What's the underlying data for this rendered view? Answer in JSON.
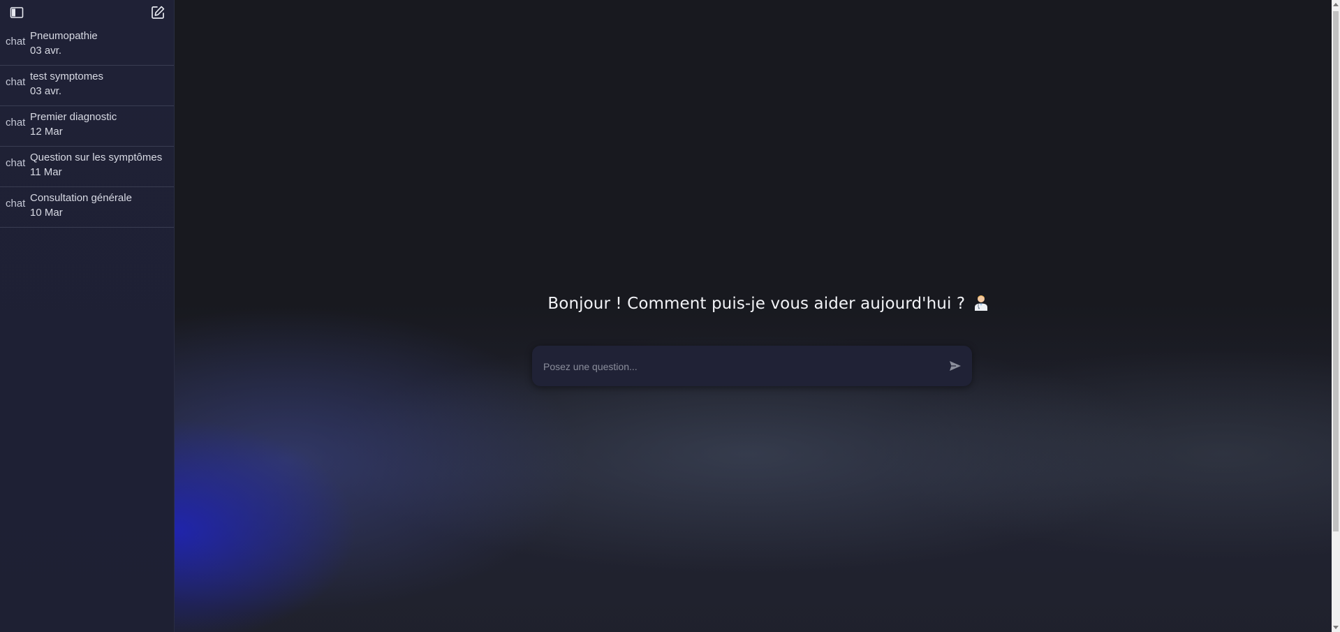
{
  "sidebar": {
    "items": [
      {
        "icon": "chat",
        "title": "Pneumopathie",
        "date": "03 avr."
      },
      {
        "icon": "chat",
        "title": "test symptomes",
        "date": "03 avr."
      },
      {
        "icon": "chat",
        "title": "Premier diagnostic",
        "date": "12 Mar"
      },
      {
        "icon": "chat",
        "title": "Question sur les symptômes",
        "date": "11 Mar"
      },
      {
        "icon": "chat",
        "title": "Consultation générale",
        "date": "10 Mar"
      }
    ]
  },
  "main": {
    "greeting": "Bonjour ! Comment puis-je vous aider aujourd'hui ?",
    "input_placeholder": "Posez une question..."
  },
  "colors": {
    "sidebar_bg": "#1f2136",
    "main_bg": "#18191f",
    "composer_bg": "#202236",
    "glow_blue": "#1e23be"
  }
}
